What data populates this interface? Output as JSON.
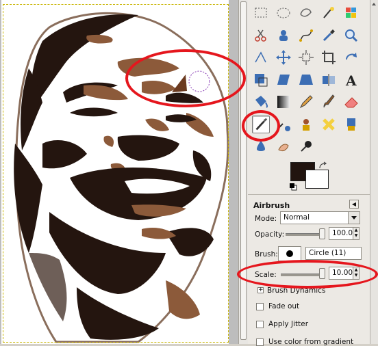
{
  "toolbox": {
    "tools": [
      "rect-select-icon",
      "ellipse-select-icon",
      "free-select-icon",
      "fuzzy-select-icon",
      "color-select-icon",
      "scissors-select-icon",
      "foreground-select-icon",
      "paths-icon",
      "color-picker-icon",
      "zoom-icon",
      "measure-icon",
      "move-icon",
      "align-icon",
      "crop-icon",
      "rotate-icon",
      "scale-icon",
      "shear-icon",
      "perspective-icon",
      "flip-icon",
      "text-icon",
      "bucket-fill-icon",
      "blend-icon",
      "pencil-icon",
      "paintbrush-icon",
      "eraser-icon",
      "airbrush-icon",
      "ink-icon",
      "clone-icon",
      "heal-icon",
      "perspective-clone-icon",
      "blur-icon",
      "smudge-icon",
      "dodge-burn-icon"
    ],
    "active_tool": "airbrush-icon",
    "foreground_color": "#21140f",
    "background_color": "#ffffff"
  },
  "tool_options": {
    "title": "Airbrush",
    "mode_label": "Mode:",
    "mode_value": "Normal",
    "opacity_label": "Opacity:",
    "opacity_value": "100.0",
    "opacity_fraction": 1.0,
    "brush_label": "Brush:",
    "brush_name": "Circle (11)",
    "scale_label": "Scale:",
    "scale_value": "10.00",
    "brush_dynamics_label": "Brush Dynamics",
    "fade_out_label": "Fade out",
    "apply_jitter_label": "Apply Jitter",
    "use_gradient_label": "Use color from gradient"
  },
  "annotations": {
    "highlight_color": "#e5161d"
  }
}
